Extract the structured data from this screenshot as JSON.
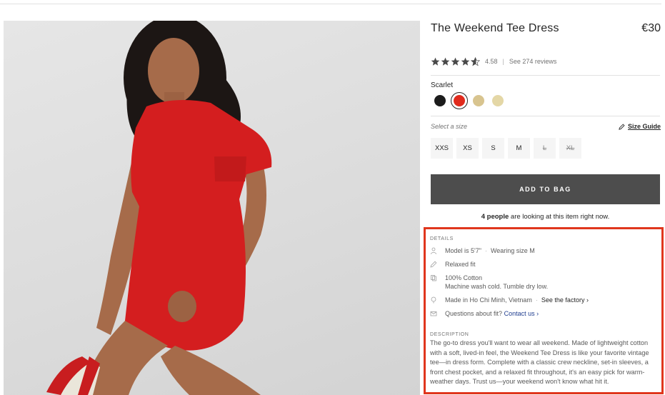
{
  "product": {
    "title": "The Weekend Tee Dress",
    "price": "€30",
    "rating_value": "4.58",
    "rating_stars": 4.58,
    "rating_separator": "|",
    "reviews_link": "See 274 reviews"
  },
  "color": {
    "selected_label": "Scarlet",
    "swatches": [
      {
        "name": "black",
        "hex": "#1c1c1c"
      },
      {
        "name": "scarlet",
        "hex": "#e02a1c",
        "selected": true
      },
      {
        "name": "tan",
        "hex": "#d8c48f"
      },
      {
        "name": "cream",
        "hex": "#e4d7a6"
      }
    ]
  },
  "size": {
    "prompt": "Select a size",
    "guide_label": "Size Guide",
    "options": [
      {
        "label": "XXS",
        "available": true
      },
      {
        "label": "XS",
        "available": true
      },
      {
        "label": "S",
        "available": true
      },
      {
        "label": "M",
        "available": true
      },
      {
        "label": "L",
        "available": false
      },
      {
        "label": "XL",
        "available": false
      }
    ]
  },
  "cart": {
    "add_label": "ADD TO BAG",
    "watching_count": "4 people",
    "watching_rest": " are looking at this item right now."
  },
  "details": {
    "heading": "DETAILS",
    "model": "Model is 5'7\"",
    "model_sep": "·",
    "wearing": "Wearing size M",
    "fit": "Relaxed fit",
    "material": "100% Cotton",
    "care": "Machine wash cold. Tumble dry low.",
    "made_in": "Made in Ho Chi Minh, Vietnam",
    "made_sep": "·",
    "factory_link": "See the factory",
    "fit_question": "Questions about fit?",
    "contact_link": "Contact us"
  },
  "description": {
    "heading": "DESCRIPTION",
    "text": "The go-to dress you'll want to wear all weekend. Made of lightweight cotton with a soft, lived-in feel, the Weekend Tee Dress is like your favorite vintage tee—in dress form. Complete with a classic crew neckline, set-in sleeves, a front chest pocket, and a relaxed fit throughout, it's an easy pick for warm-weather days. Trust us—your weekend won't know what hit it."
  },
  "icons": {
    "star": "star-icon",
    "pencil": "pencil-icon",
    "person": "person-icon",
    "tag": "tag-icon",
    "pin": "location-pin-icon",
    "mail": "mail-icon",
    "chevron": "chevron-right-icon"
  },
  "colors": {
    "highlight_border": "#e0361d",
    "button_bg": "#4d4d4d",
    "link_blue": "#1f3d8f"
  }
}
